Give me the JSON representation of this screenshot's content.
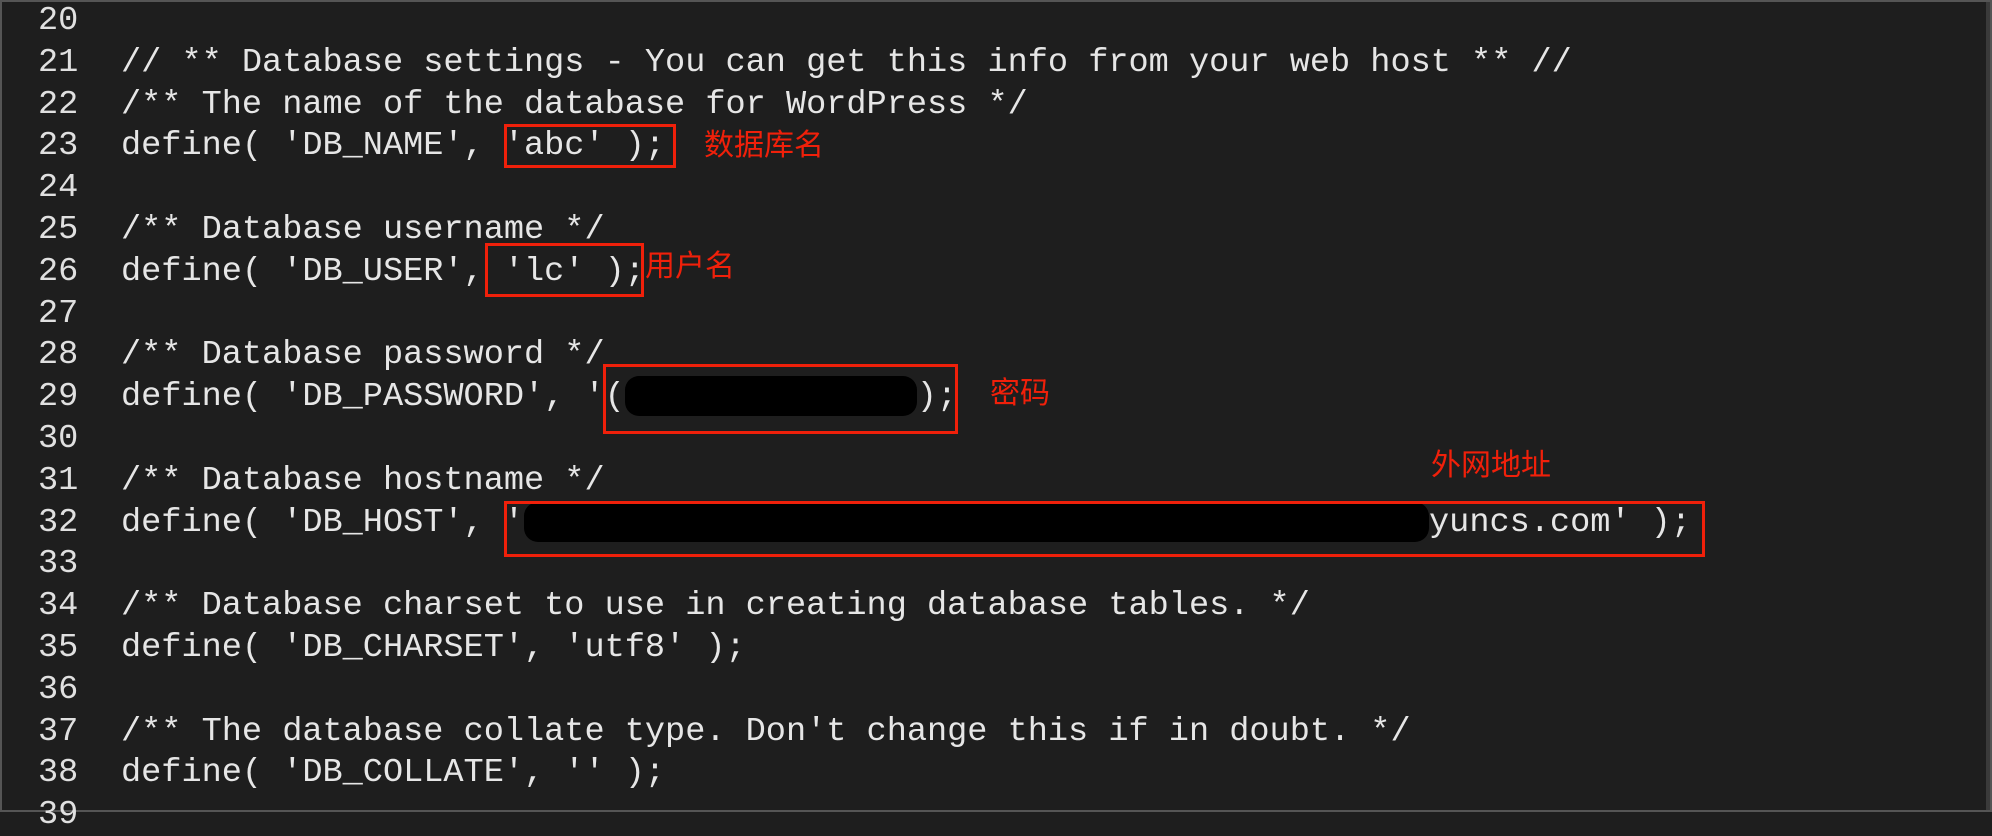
{
  "editor": {
    "lines": [
      {
        "num": "20",
        "text": ""
      },
      {
        "num": "21",
        "text": "// ** Database settings - You can get this info from your web host ** //"
      },
      {
        "num": "22",
        "text": "/** The name of the database for WordPress */"
      },
      {
        "num": "23",
        "text": "define( 'DB_NAME', 'abc' );"
      },
      {
        "num": "24",
        "text": ""
      },
      {
        "num": "25",
        "text": "/** Database username */"
      },
      {
        "num": "26",
        "text": "define( 'DB_USER', 'lc' );"
      },
      {
        "num": "27",
        "text": ""
      },
      {
        "num": "28",
        "text": "/** Database password */"
      },
      {
        "num": "29",
        "text": "define( 'DB_PASSWORD', '(",
        "after": ");"
      },
      {
        "num": "30",
        "text": ""
      },
      {
        "num": "31",
        "text": "/** Database hostname */"
      },
      {
        "num": "32",
        "text": "define( 'DB_HOST', '",
        "after": "yuncs.com' );"
      },
      {
        "num": "33",
        "text": ""
      },
      {
        "num": "34",
        "text": "/** Database charset to use in creating database tables. */"
      },
      {
        "num": "35",
        "text": "define( 'DB_CHARSET', 'utf8' );"
      },
      {
        "num": "36",
        "text": ""
      },
      {
        "num": "37",
        "text": "/** The database collate type. Don't change this if in doubt. */"
      },
      {
        "num": "38",
        "text": "define( 'DB_COLLATE', '' );"
      },
      {
        "num": "39",
        "text": ""
      }
    ]
  },
  "annotations": {
    "db_name": "数据库名",
    "db_user": "用户名",
    "db_password": "密码",
    "db_host": "外网地址"
  },
  "colors": {
    "background": "#1e1e1e",
    "text": "#e6e6e6",
    "annotation": "#f0200a",
    "redaction": "#000000"
  }
}
